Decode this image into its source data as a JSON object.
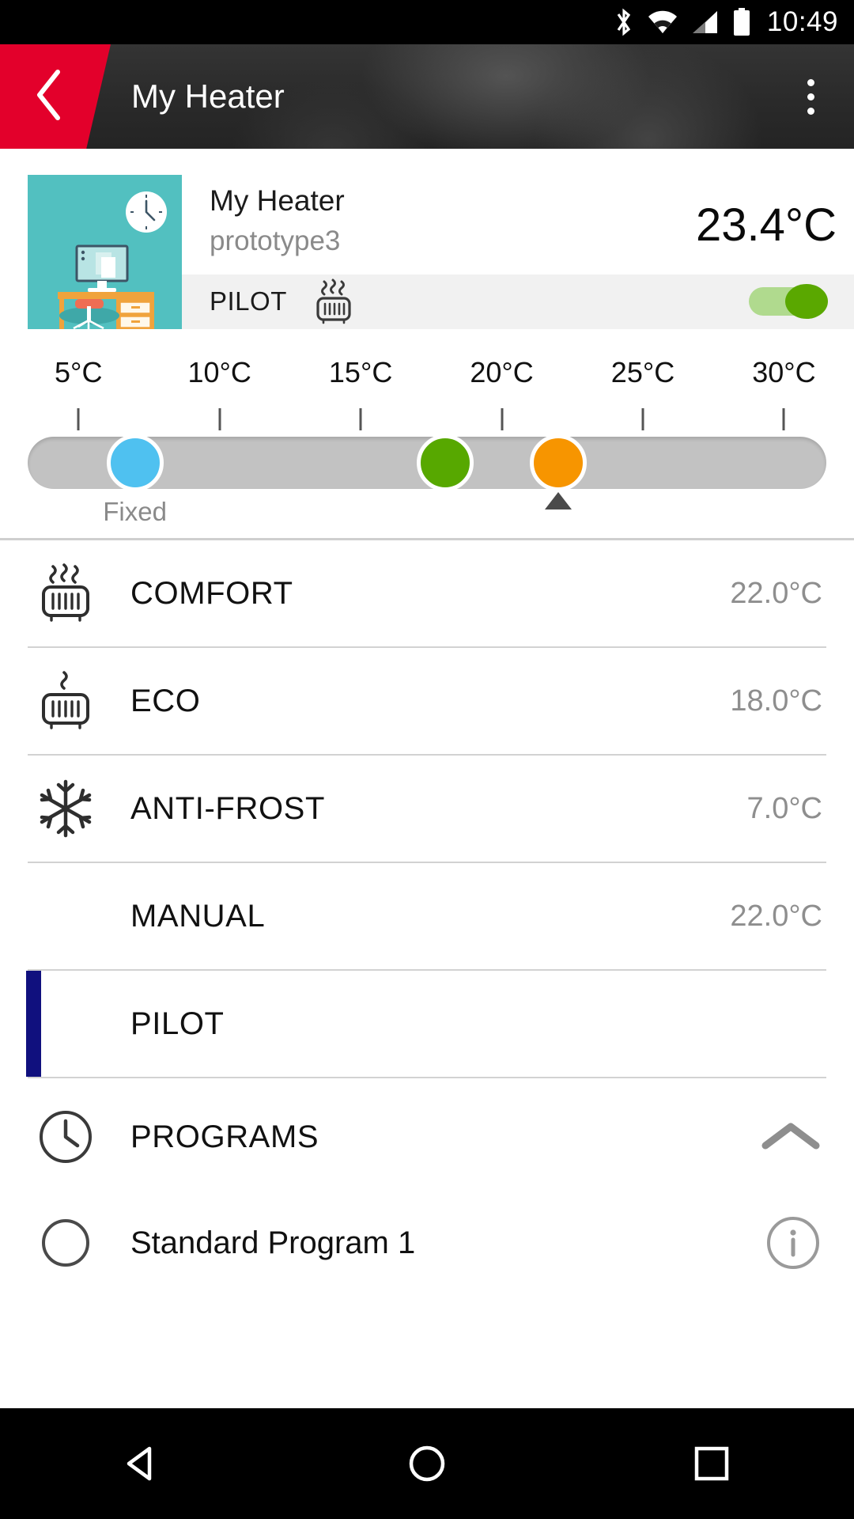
{
  "statusbar": {
    "time": "10:49",
    "icons": [
      "bluetooth-icon",
      "wifi-icon",
      "cellular-signal-icon",
      "battery-icon"
    ]
  },
  "appbar": {
    "title": "My Heater",
    "back_icon": "chevron-left-icon",
    "overflow_icon": "overflow-menu-icon",
    "accent_color": "#e3002b"
  },
  "device": {
    "thumbnail_name": "room-illustration-thumbnail",
    "name": "My Heater",
    "subtitle": "prototype3",
    "temperature": "23.4°C",
    "pilot": {
      "label": "PILOT",
      "icon": "radiator-heat-icon",
      "toggle_on": true,
      "toggle_color": "#5aa800"
    }
  },
  "scale": {
    "labels": [
      "5°C",
      "10°C",
      "15°C",
      "20°C",
      "25°C",
      "30°C"
    ],
    "label_values": [
      5,
      10,
      15,
      20,
      25,
      30
    ],
    "min": 3.2,
    "max": 31.5,
    "markers": [
      {
        "name": "anti-frost-marker",
        "value": 7.0,
        "color": "#4fc1f0"
      },
      {
        "name": "eco-marker",
        "value": 18.0,
        "color": "#57a800"
      },
      {
        "name": "comfort-marker",
        "value": 22.0,
        "color": "#f79500"
      }
    ],
    "fixed_label": "Fixed",
    "fixed_at": 7.0,
    "current_pointer": 22.0
  },
  "modes": [
    {
      "name": "COMFORT",
      "temp": "22.0°C",
      "icon": "radiator-heat-3-icon",
      "selected": false
    },
    {
      "name": "ECO",
      "temp": "18.0°C",
      "icon": "radiator-heat-1-icon",
      "selected": false
    },
    {
      "name": "ANTI-FROST",
      "temp": "7.0°C",
      "icon": "snowflake-icon",
      "selected": false
    },
    {
      "name": "MANUAL",
      "temp": "22.0°C",
      "icon": "",
      "selected": false
    },
    {
      "name": "PILOT",
      "temp": "",
      "icon": "",
      "selected": true
    }
  ],
  "programs": {
    "label": "PROGRAMS",
    "clock_icon": "clock-icon",
    "chevron_icon": "chevron-up-icon",
    "items": [
      {
        "label": "Standard Program 1",
        "radio_icon": "radio-unchecked-icon",
        "info_icon": "info-icon"
      }
    ]
  },
  "navbar": {
    "back_icon": "nav-back-triangle-icon",
    "home_icon": "nav-home-circle-icon",
    "recents_icon": "nav-recents-square-icon"
  },
  "colors": {
    "accent_red": "#e3002b",
    "selected_blue": "#10107e",
    "thumb_teal": "#52c0c0"
  }
}
